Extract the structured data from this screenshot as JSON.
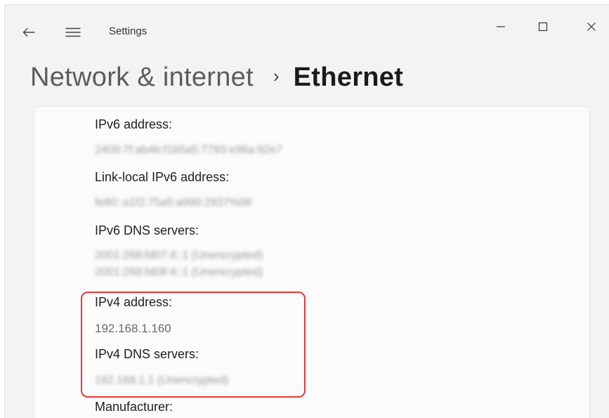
{
  "window": {
    "title": "Settings"
  },
  "breadcrumb": {
    "parent": "Network & internet",
    "separator": "›",
    "current": "Ethernet"
  },
  "properties": {
    "ipv6_address": {
      "label": "IPv6 address:",
      "value": "2409:7f:ab4b:f1b5a5:7793:e96a:92e7"
    },
    "link_local_ipv6": {
      "label": "Link-local IPv6 address:",
      "value": "fe80::a1f2:75a5:a990:2937%08"
    },
    "ipv6_dns": {
      "label": "IPv6 DNS servers:",
      "values": [
        "2001:268:fd07:4::1 (Unencrypted)",
        "2001:268:fd08:4::1 (Unencrypted)"
      ]
    },
    "ipv4_address": {
      "label": "IPv4 address:",
      "value": "192.168.1.160"
    },
    "ipv4_dns": {
      "label": "IPv4 DNS servers:",
      "value": "192.168.1.1 (Unencrypted)"
    },
    "manufacturer": {
      "label": "Manufacturer:"
    }
  },
  "colors": {
    "highlight_border": "#e0393b",
    "window_bg": "#f3f3f3",
    "card_bg": "#fbfbfb"
  },
  "icons": {
    "back": "arrow-left-icon",
    "menu": "hamburger-menu-icon",
    "minimize": "minimize-icon",
    "maximize": "maximize-icon",
    "close": "close-icon"
  }
}
